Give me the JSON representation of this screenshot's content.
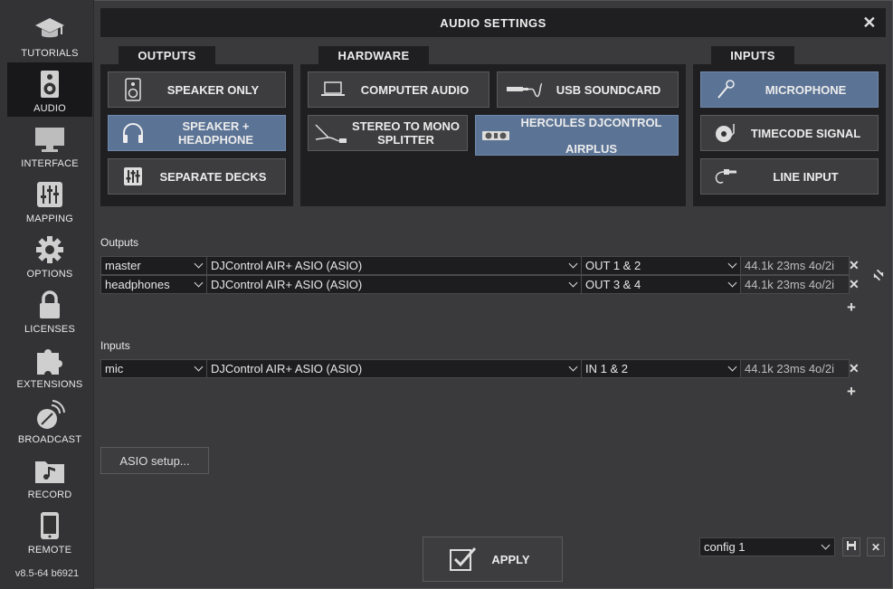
{
  "window": {
    "title": "AUDIO SETTINGS"
  },
  "sidebar": {
    "items": [
      {
        "label": "TUTORIALS",
        "icon": "graduation-cap-icon"
      },
      {
        "label": "AUDIO",
        "icon": "speaker-icon",
        "active": true
      },
      {
        "label": "INTERFACE",
        "icon": "monitor-icon"
      },
      {
        "label": "MAPPING",
        "icon": "sliders-icon"
      },
      {
        "label": "OPTIONS",
        "icon": "gear-icon"
      },
      {
        "label": "LICENSES",
        "icon": "lock-icon"
      },
      {
        "label": "EXTENSIONS",
        "icon": "puzzle-icon"
      },
      {
        "label": "BROADCAST",
        "icon": "satellite-dish-icon"
      },
      {
        "label": "RECORD",
        "icon": "music-folder-icon"
      },
      {
        "label": "REMOTE",
        "icon": "phone-icon"
      }
    ],
    "version": "v8.5-64 b6921"
  },
  "outputs_section": {
    "title": "OUTPUTS",
    "buttons": [
      {
        "label": "SPEAKER ONLY",
        "icon": "speaker-icon",
        "selected": false
      },
      {
        "label": "SPEAKER + HEADPHONE",
        "icon": "headphones-icon",
        "selected": true
      },
      {
        "label": "SEPARATE DECKS",
        "icon": "mixer-icon",
        "selected": false
      }
    ]
  },
  "hardware_section": {
    "title": "HARDWARE",
    "buttons": [
      {
        "label": "COMPUTER AUDIO",
        "icon": "laptop-icon",
        "selected": false
      },
      {
        "label": "USB SOUNDCARD",
        "icon": "usb-cable-icon",
        "selected": false
      },
      {
        "label": "STEREO TO MONO SPLITTER",
        "icon": "splitter-cable-icon",
        "selected": false
      },
      {
        "label": "HERCULES DJCONTROL AIRPLUS",
        "icon": "dj-controller-icon",
        "selected": true
      }
    ]
  },
  "inputs_section": {
    "title": "INPUTS",
    "buttons": [
      {
        "label": "MICROPHONE",
        "icon": "microphone-icon",
        "selected": true
      },
      {
        "label": "TIMECODE SIGNAL",
        "icon": "turntable-icon",
        "selected": false
      },
      {
        "label": "LINE INPUT",
        "icon": "jack-cable-icon",
        "selected": false
      }
    ]
  },
  "outputs_table": {
    "label": "Outputs",
    "rows": [
      {
        "name": "master",
        "device": "DJControl AIR+ ASIO (ASIO)",
        "channels": "OUT 1 & 2",
        "info": "44.1k 23ms 4o/2i"
      },
      {
        "name": "headphones",
        "device": "DJControl AIR+ ASIO (ASIO)",
        "channels": "OUT 3 & 4",
        "info": "44.1k 23ms 4o/2i"
      }
    ]
  },
  "inputs_table": {
    "label": "Inputs",
    "rows": [
      {
        "name": "mic",
        "device": "DJControl AIR+ ASIO (ASIO)",
        "channels": "IN 1 & 2",
        "info": "44.1k 23ms 4o/2i"
      }
    ]
  },
  "asio_button": {
    "label": "ASIO setup..."
  },
  "apply_button": {
    "label": "APPLY"
  },
  "config": {
    "selected": "config 1"
  },
  "colors": {
    "selected_button": "#5b7395",
    "panel": "#1f1f21",
    "background": "#3a3a3c"
  }
}
